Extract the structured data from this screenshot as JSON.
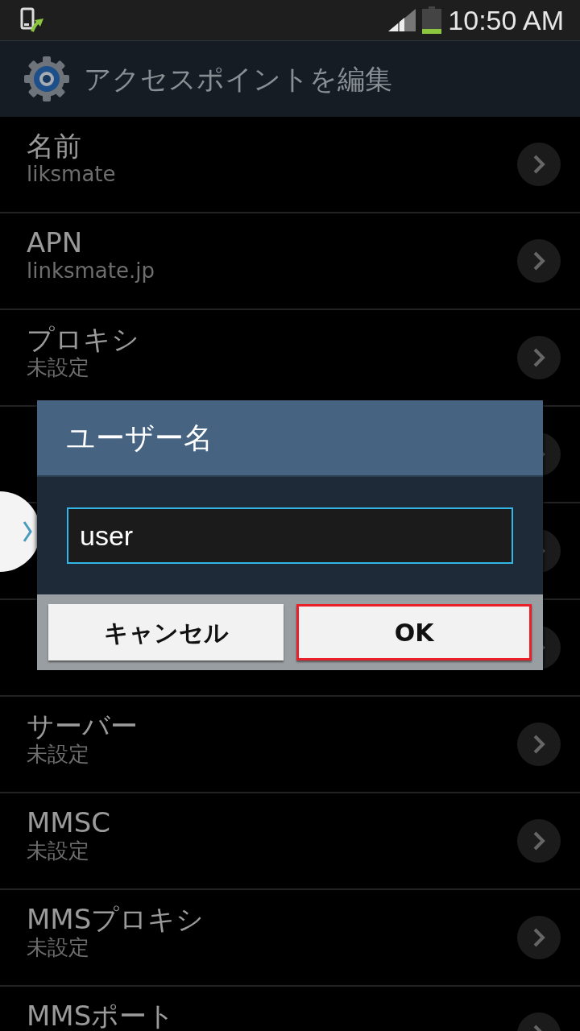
{
  "status_bar": {
    "time": "10:50 AM"
  },
  "action_bar": {
    "title": "アクセスポイントを編集"
  },
  "rows": [
    {
      "kind": "setting",
      "title": "名前",
      "value": "liksmate"
    },
    {
      "kind": "setting",
      "title": "APN",
      "value": "linksmate.jp"
    },
    {
      "kind": "setting",
      "title": "プロキシ",
      "value": "未設定"
    },
    {
      "kind": "covered"
    },
    {
      "kind": "covered"
    },
    {
      "kind": "covered"
    },
    {
      "kind": "setting",
      "title": "サーバー",
      "value": "未設定"
    },
    {
      "kind": "setting",
      "title": "MMSC",
      "value": "未設定"
    },
    {
      "kind": "setting",
      "title": "MMSプロキシ",
      "value": "未設定"
    },
    {
      "kind": "setting",
      "title": "MMSポート"
    }
  ],
  "dialog": {
    "title": "ユーザー名",
    "input_value": "user",
    "buttons": [
      {
        "label": "キャンセル",
        "highlighted": false
      },
      {
        "label": "OK",
        "highlighted": true
      }
    ]
  }
}
